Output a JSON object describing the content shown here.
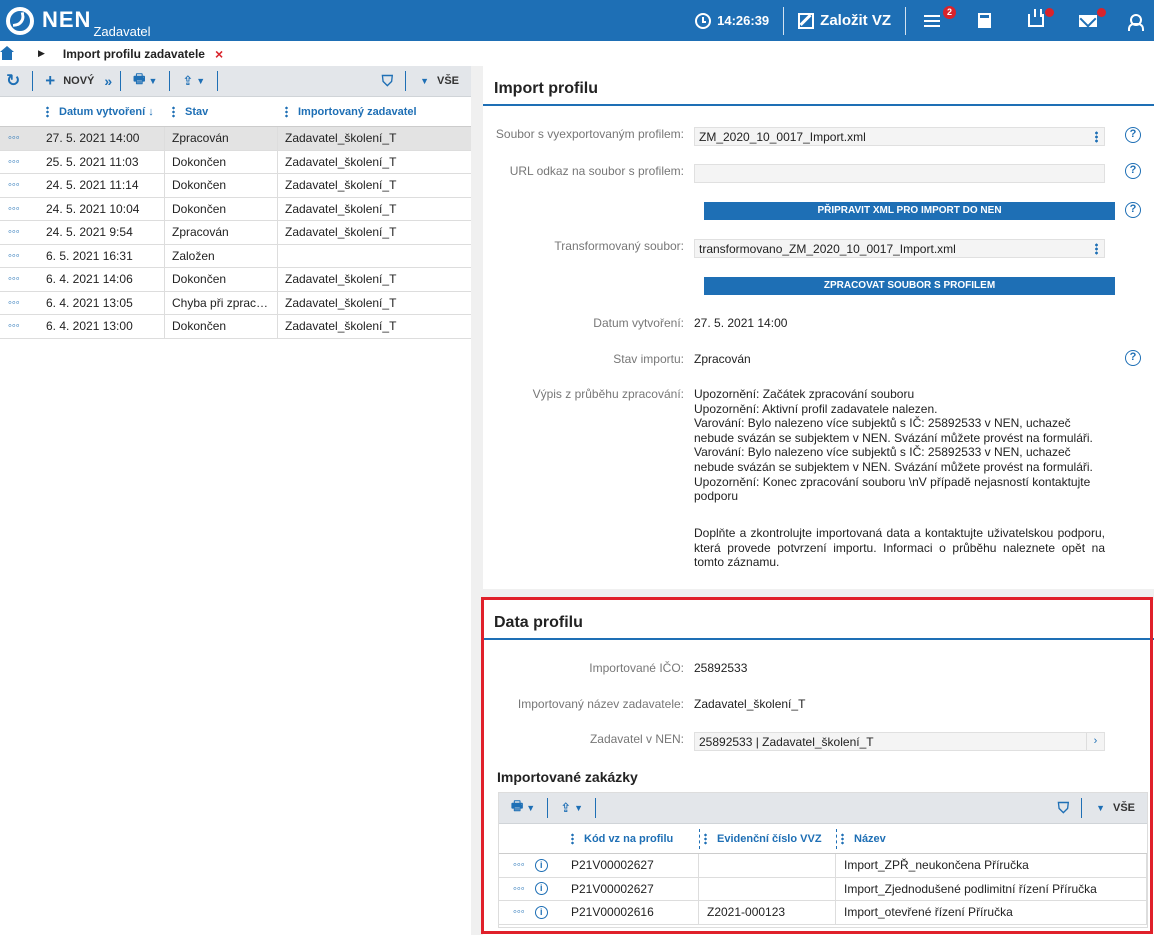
{
  "app": {
    "name": "NEN",
    "subtitle": "Zadavatel"
  },
  "topbar": {
    "time": "14:26:39",
    "create_label": "Založit VZ",
    "notif_count": "2"
  },
  "breadcrumb": {
    "current": "Import profilu zadavatele",
    "close": "×"
  },
  "list": {
    "toolbar": {
      "new_label": "NOVÝ",
      "all_label": "VŠE"
    },
    "columns": [
      "Datum vytvoření ↓",
      "Stav",
      "Importovaný zadavatel"
    ],
    "rows": [
      {
        "date": "27. 5. 2021 14:00",
        "state": "Zpracován",
        "entity": "Zadavatel_školení_T"
      },
      {
        "date": "25. 5. 2021 11:03",
        "state": "Dokončen",
        "entity": "Zadavatel_školení_T"
      },
      {
        "date": "24. 5. 2021 11:14",
        "state": "Dokončen",
        "entity": "Zadavatel_školení_T"
      },
      {
        "date": "24. 5. 2021 10:04",
        "state": "Dokončen",
        "entity": "Zadavatel_školení_T"
      },
      {
        "date": "24. 5. 2021 9:54",
        "state": "Zpracován",
        "entity": "Zadavatel_školení_T"
      },
      {
        "date": "6. 5. 2021 16:31",
        "state": "Založen",
        "entity": ""
      },
      {
        "date": "6. 4. 2021 14:06",
        "state": "Dokončen",
        "entity": "Zadavatel_školení_T"
      },
      {
        "date": "6. 4. 2021 13:05",
        "state": "Chyba při zprac…",
        "entity": "Zadavatel_školení_T"
      },
      {
        "date": "6. 4. 2021 13:00",
        "state": "Dokončen",
        "entity": "Zadavatel_školení_T"
      }
    ]
  },
  "import": {
    "title": "Import profilu",
    "file_label": "Soubor s vyexportovaným profilem:",
    "file_value": "ZM_2020_10_0017_Import.xml",
    "url_label": "URL odkaz na soubor s profilem:",
    "url_value": "",
    "prepare_button": "PŘIPRAVIT XML PRO IMPORT DO NEN",
    "transformed_label": "Transformovaný soubor:",
    "transformed_value": "transformovano_ZM_2020_10_0017_Import.xml",
    "process_button": "ZPRACOVAT SOUBOR S PROFILEM",
    "date_label": "Datum vytvoření:",
    "date_value": "27. 5. 2021 14:00",
    "state_label": "Stav importu:",
    "state_value": "Zpracován",
    "log_label": "Výpis z průběhu zpracování:",
    "log_lines": [
      "Upozornění: Začátek zpracování souboru",
      "Upozornění: Aktivní profil zadavatele nalezen.",
      "Varování: Bylo nalezeno více subjektů s IČ: 25892533 v NEN, uchazeč nebude svázán se subjektem v NEN. Svázání můžete provést na formuláři.",
      "Varování: Bylo nalezeno více subjektů s IČ: 25892533 v NEN, uchazeč nebude svázán se subjektem v NEN. Svázání můžete provést na formuláři.",
      "Upozornění: Konec zpracování souboru \\nV případě nejasností kontaktujte podporu"
    ],
    "note": "Doplňte a zkontrolujte importovaná data a kontaktujte uživatelskou podporu, která provede potvrzení importu. Informaci o průběhu naleznete opět na tomto záznamu."
  },
  "profile": {
    "title": "Data profilu",
    "ico_label": "Importované IČO:",
    "ico_value": "25892533",
    "name_label": "Importovaný název zadavatele:",
    "name_value": "Zadavatel_školení_T",
    "nen_label": "Zadavatel v NEN:",
    "nen_value": "25892533 | Zadavatel_školení_T",
    "orders_title": "Importované zakázky",
    "all_label": "VŠE",
    "columns": [
      "Kód vz na profilu",
      "Evidenční číslo VVZ",
      "Název"
    ],
    "rows": [
      {
        "code": "P21V00002627",
        "vvz": "",
        "name": "Import_ZPŘ_neukončena Příručka"
      },
      {
        "code": "P21V00002627",
        "vvz": "",
        "name": "Import_Zjednodušené podlimitní řízení Příručka"
      },
      {
        "code": "P21V00002616",
        "vvz": "Z2021-000123",
        "name": "Import_otevřené řízení Příručka"
      }
    ]
  },
  "colors": {
    "brand": "#1e6fb5",
    "highlight": "#e0202a"
  }
}
